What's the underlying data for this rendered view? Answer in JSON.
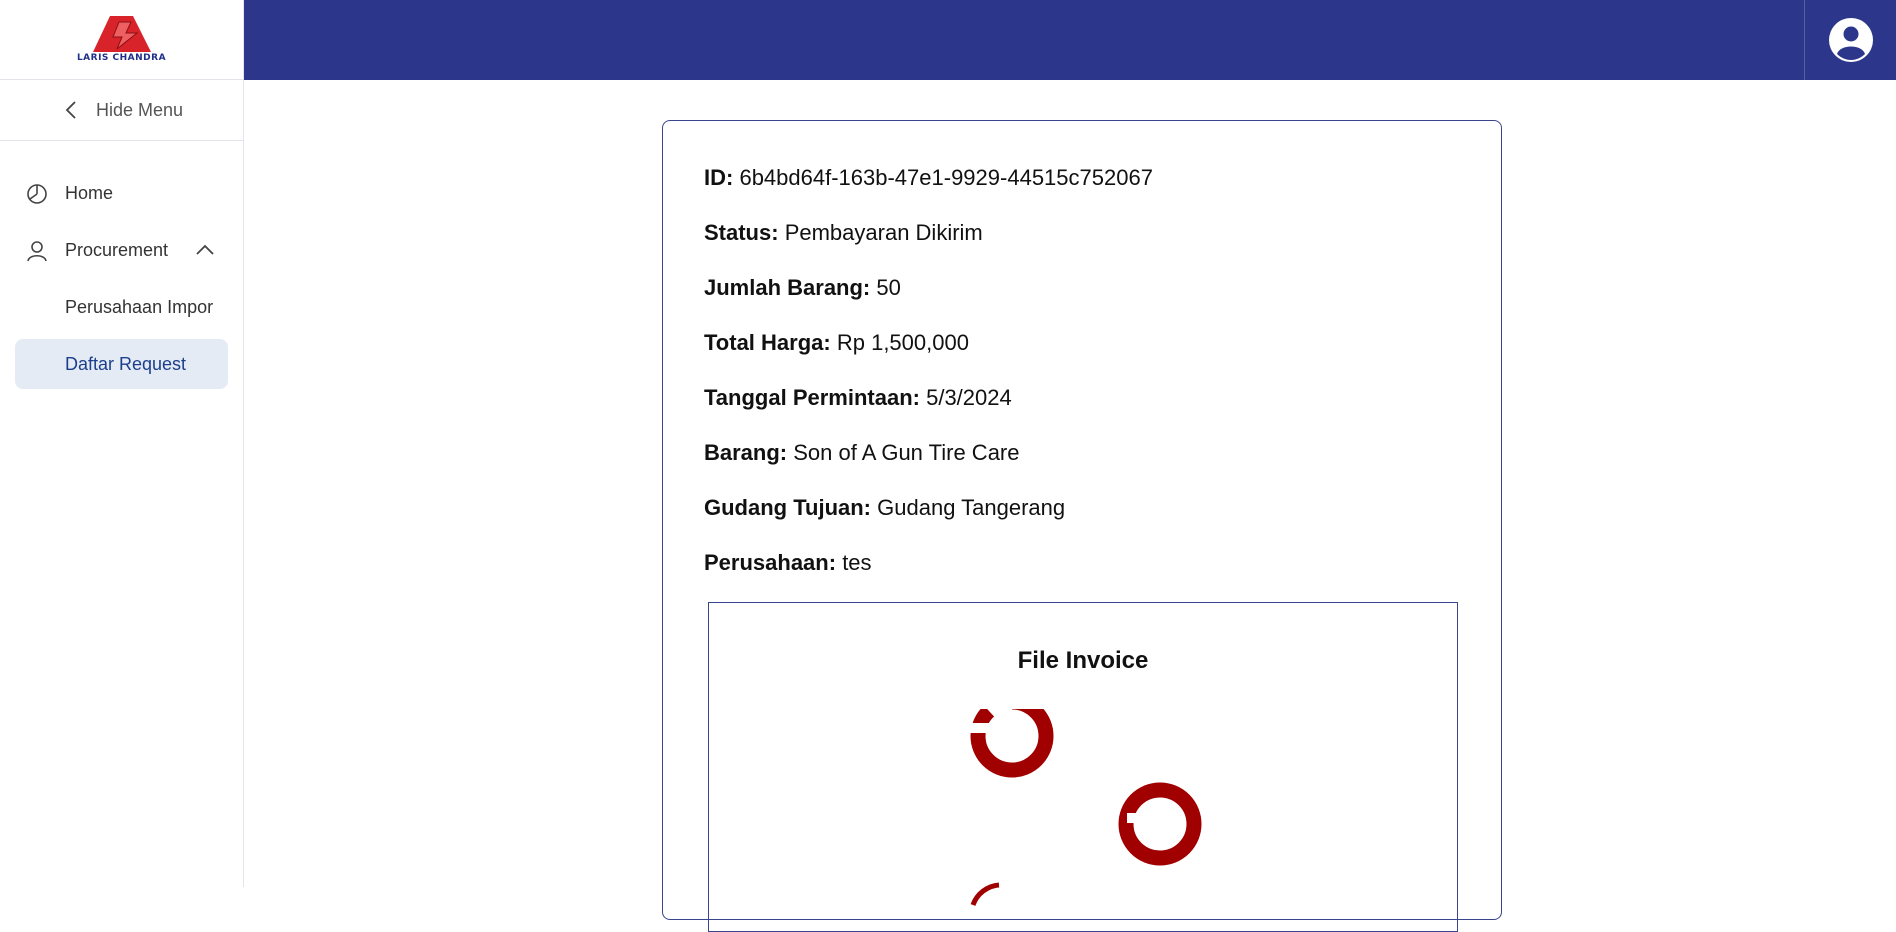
{
  "brand": {
    "name": "LARIS CHANDRA"
  },
  "sidebar": {
    "hide_menu_label": "Hide Menu",
    "items": [
      {
        "label": "Home",
        "icon": "pie-chart-icon"
      },
      {
        "label": "Procurement",
        "icon": "user-icon",
        "expanded": true
      },
      {
        "label": "Perusahaan Impor"
      },
      {
        "label": "Daftar Request",
        "active": true
      }
    ]
  },
  "header": {
    "avatar_icon": "user-circle-icon"
  },
  "detail": {
    "id_label": "ID:",
    "id_value": "6b4bd64f-163b-47e1-9929-44515c752067",
    "status_label": "Status:",
    "status_value": "Pembayaran Dikirim",
    "qty_label": "Jumlah Barang:",
    "qty_value": "50",
    "total_label": "Total Harga:",
    "total_value": "Rp 1,500,000",
    "date_label": "Tanggal Permintaan:",
    "date_value": "5/3/2024",
    "item_label": "Barang:",
    "item_value": "Son of A Gun Tire Care",
    "warehouse_label": "Gudang Tujuan:",
    "warehouse_value": "Gudang Tangerang",
    "company_label": "Perusahaan:",
    "company_value": "tes"
  },
  "invoice": {
    "title": "File Invoice"
  },
  "colors": {
    "header": "#2c378c",
    "active_bg": "#e5ebf5",
    "spinner": "#a00000"
  }
}
